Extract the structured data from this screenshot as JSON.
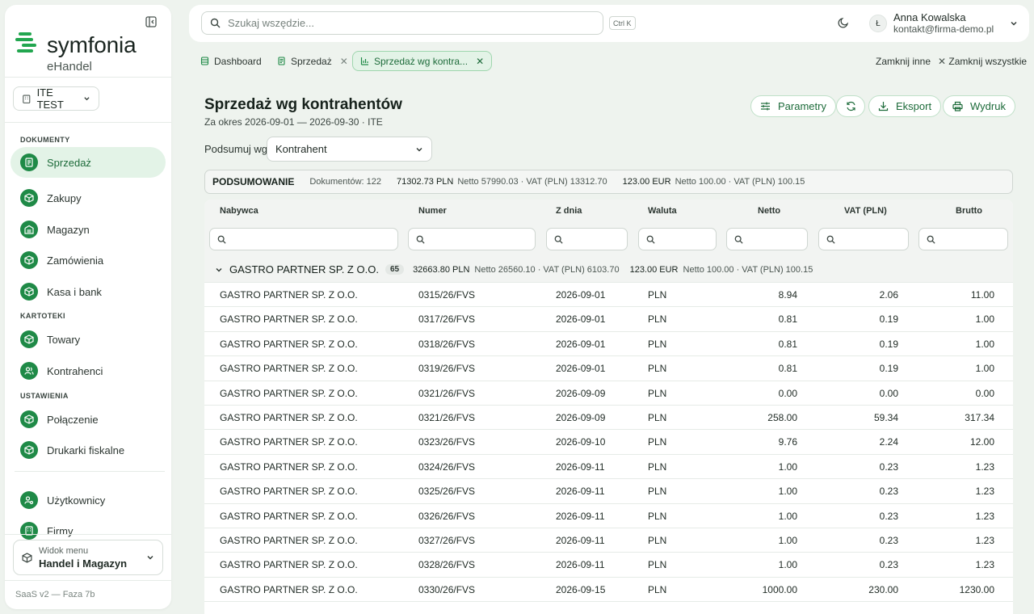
{
  "sidebar": {
    "logo_name": "symfonia",
    "logo_sub": "eHandel",
    "company": "ITE TEST",
    "sections": {
      "documents": "DOKUMENTY",
      "cards": "KARTOTEKI",
      "settings": "USTAWIENIA"
    },
    "items": {
      "sales": "Sprzedaż",
      "purchases": "Zakupy",
      "warehouse": "Magazyn",
      "orders": "Zamówienia",
      "cash": "Kasa i bank",
      "goods": "Towary",
      "contractors": "Kontrahenci",
      "connection": "Połączenie",
      "printers": "Drukarki fiskalne",
      "users": "Użytkownicy",
      "companies": "Firmy"
    },
    "menu_view_label": "Widok menu",
    "menu_view_value": "Handel i Magazyn",
    "version": "SaaS v2 — Faza 7b"
  },
  "topbar": {
    "search_placeholder": "Szukaj wszędzie...",
    "shortcut": "Ctrl K",
    "avatar_initial": "Ł",
    "user_name": "Anna Kowalska",
    "user_email": "kontakt@firma-demo.pl"
  },
  "tabs": {
    "dashboard": "Dashboard",
    "sales": "Sprzedaż",
    "sales_by_contractor": "Sprzedaż wg kontra...",
    "close_others": "Zamknij inne",
    "close_all": "Zamknij wszystkie"
  },
  "page": {
    "title": "Sprzedaż wg kontrahentów",
    "subtitle": "Za okres 2026-09-01 — 2026-09-30 · ITE",
    "btn_params": "Parametry",
    "btn_export": "Eksport",
    "btn_print": "Wydruk",
    "group_label": "Podsumuj wg",
    "group_value": "Kontrahent"
  },
  "summary": {
    "title": "PODSUMOWANIE",
    "docs": "Dokumentów: 122",
    "pln_amount": "71302.73 PLN",
    "pln_detail": "Netto 57990.03 · VAT (PLN) 13312.70",
    "eur_amount": "123.00 EUR",
    "eur_detail": "Netto 100.00 · VAT (PLN) 100.15"
  },
  "table": {
    "columns": {
      "buyer": "Nabywca",
      "number": "Numer",
      "date": "Z dnia",
      "currency": "Waluta",
      "net": "Netto",
      "vat": "VAT (PLN)",
      "gross": "Brutto"
    },
    "group": {
      "name": "GASTRO PARTNER SP. Z O.O.",
      "count": "65",
      "pln_amount": "32663.80 PLN",
      "pln_detail": "Netto 26560.10 · VAT (PLN) 6103.70",
      "eur_amount": "123.00 EUR",
      "eur_detail": "Netto 100.00 · VAT (PLN) 100.15"
    },
    "rows": [
      {
        "buyer": "GASTRO PARTNER SP. Z O.O.",
        "number": "0315/26/FVS",
        "date": "2026-09-01",
        "currency": "PLN",
        "net": "8.94",
        "vat": "2.06",
        "gross": "11.00"
      },
      {
        "buyer": "GASTRO PARTNER SP. Z O.O.",
        "number": "0317/26/FVS",
        "date": "2026-09-01",
        "currency": "PLN",
        "net": "0.81",
        "vat": "0.19",
        "gross": "1.00"
      },
      {
        "buyer": "GASTRO PARTNER SP. Z O.O.",
        "number": "0318/26/FVS",
        "date": "2026-09-01",
        "currency": "PLN",
        "net": "0.81",
        "vat": "0.19",
        "gross": "1.00"
      },
      {
        "buyer": "GASTRO PARTNER SP. Z O.O.",
        "number": "0319/26/FVS",
        "date": "2026-09-01",
        "currency": "PLN",
        "net": "0.81",
        "vat": "0.19",
        "gross": "1.00"
      },
      {
        "buyer": "GASTRO PARTNER SP. Z O.O.",
        "number": "0321/26/FVS",
        "date": "2026-09-09",
        "currency": "PLN",
        "net": "0.00",
        "vat": "0.00",
        "gross": "0.00"
      },
      {
        "buyer": "GASTRO PARTNER SP. Z O.O.",
        "number": "0321/26/FVS",
        "date": "2026-09-09",
        "currency": "PLN",
        "net": "258.00",
        "vat": "59.34",
        "gross": "317.34"
      },
      {
        "buyer": "GASTRO PARTNER SP. Z O.O.",
        "number": "0323/26/FVS",
        "date": "2026-09-10",
        "currency": "PLN",
        "net": "9.76",
        "vat": "2.24",
        "gross": "12.00"
      },
      {
        "buyer": "GASTRO PARTNER SP. Z O.O.",
        "number": "0324/26/FVS",
        "date": "2026-09-11",
        "currency": "PLN",
        "net": "1.00",
        "vat": "0.23",
        "gross": "1.23"
      },
      {
        "buyer": "GASTRO PARTNER SP. Z O.O.",
        "number": "0325/26/FVS",
        "date": "2026-09-11",
        "currency": "PLN",
        "net": "1.00",
        "vat": "0.23",
        "gross": "1.23"
      },
      {
        "buyer": "GASTRO PARTNER SP. Z O.O.",
        "number": "0326/26/FVS",
        "date": "2026-09-11",
        "currency": "PLN",
        "net": "1.00",
        "vat": "0.23",
        "gross": "1.23"
      },
      {
        "buyer": "GASTRO PARTNER SP. Z O.O.",
        "number": "0327/26/FVS",
        "date": "2026-09-11",
        "currency": "PLN",
        "net": "1.00",
        "vat": "0.23",
        "gross": "1.23"
      },
      {
        "buyer": "GASTRO PARTNER SP. Z O.O.",
        "number": "0328/26/FVS",
        "date": "2026-09-11",
        "currency": "PLN",
        "net": "1.00",
        "vat": "0.23",
        "gross": "1.23"
      },
      {
        "buyer": "GASTRO PARTNER SP. Z O.O.",
        "number": "0330/26/FVS",
        "date": "2026-09-15",
        "currency": "PLN",
        "net": "1000.00",
        "vat": "230.00",
        "gross": "1230.00"
      }
    ]
  },
  "colors": {
    "accent": "#1f8a47",
    "accent_soft": "#e3f3e7",
    "background": "#eef3ee"
  }
}
